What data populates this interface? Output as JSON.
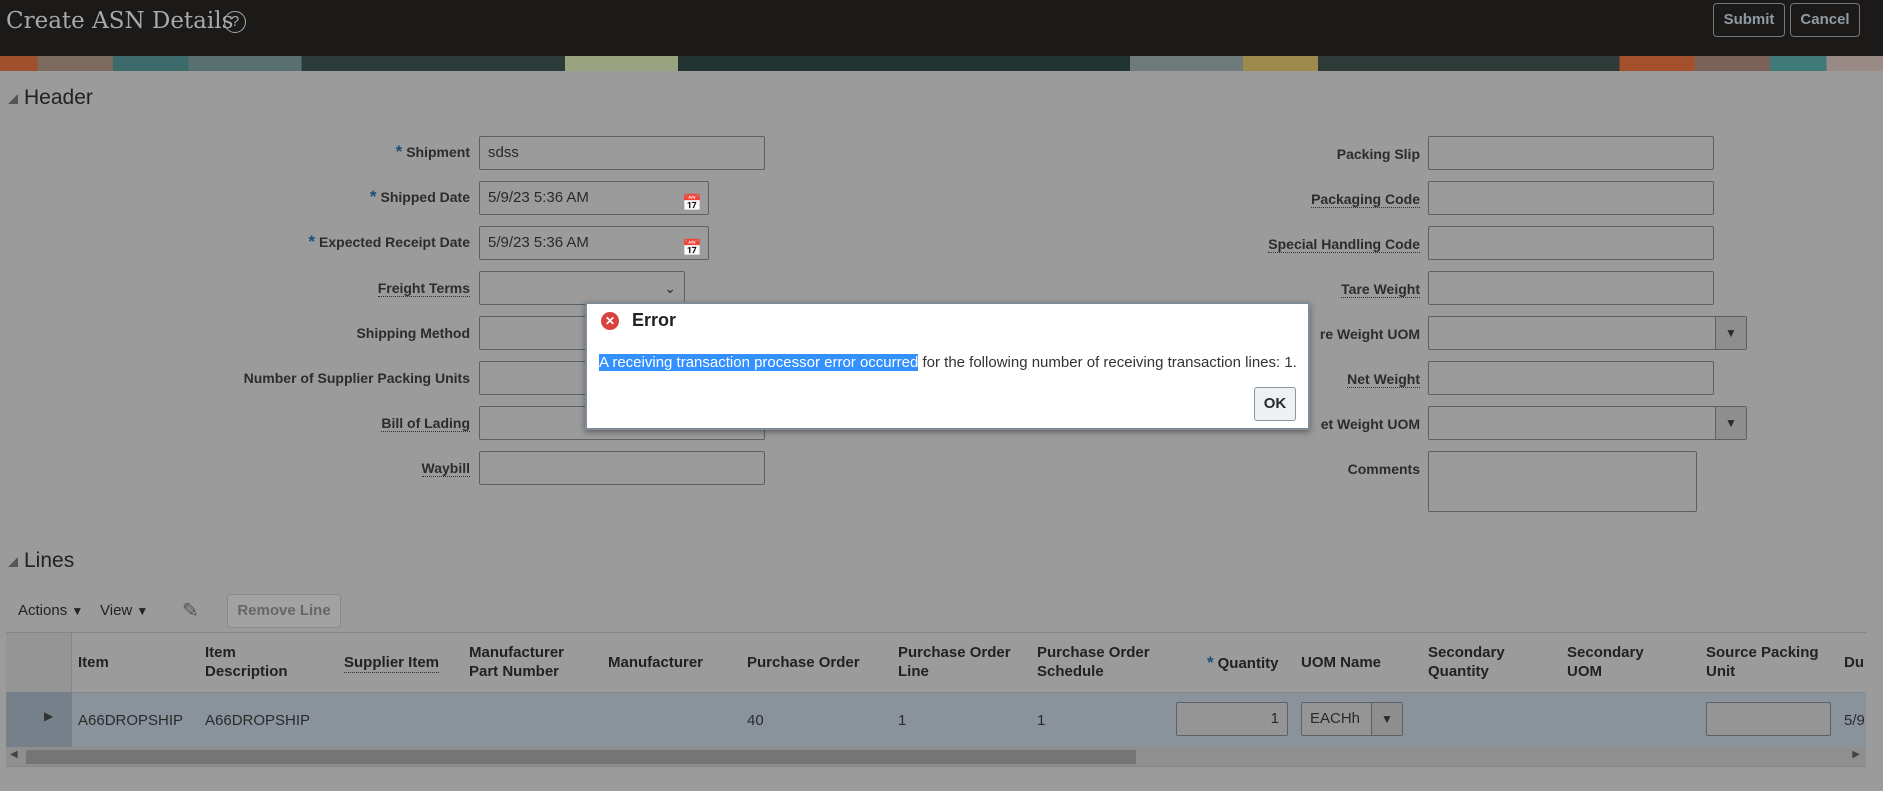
{
  "page": {
    "title": "Create ASN Details",
    "help_icon": "?",
    "submit_label": "Submit",
    "cancel_label": "Cancel"
  },
  "header": {
    "section_title": "Header",
    "left_fields": [
      {
        "label": "Shipment",
        "required": "*",
        "value": "sdss"
      },
      {
        "label": "Shipped Date",
        "required": "*",
        "value": "5/9/23 5:36 AM"
      },
      {
        "label": "Expected Receipt Date",
        "required": "*",
        "value": "5/9/23 5:36 AM"
      },
      {
        "label": "Freight Terms",
        "value": ""
      },
      {
        "label": "Shipping Method",
        "value": ""
      },
      {
        "label": "Number of Supplier Packing Units",
        "value": ""
      },
      {
        "label": "Bill of Lading",
        "value": ""
      },
      {
        "label": "Waybill",
        "value": ""
      }
    ],
    "right_fields": [
      {
        "label": "Packing Slip",
        "value": ""
      },
      {
        "label": "Packaging Code",
        "value": ""
      },
      {
        "label": "Special Handling Code",
        "value": ""
      },
      {
        "label": "Tare Weight",
        "value": ""
      },
      {
        "label": "re Weight UOM",
        "value": ""
      },
      {
        "label": "Net Weight",
        "value": ""
      },
      {
        "label": "et Weight UOM",
        "value": ""
      },
      {
        "label": "Comments",
        "value": ""
      }
    ]
  },
  "dialog": {
    "title": "Error",
    "message_highlighted": "A receiving transaction processor error occurred",
    "message_rest": " for the following number of receiving transaction lines: 1.",
    "ok_label": "OK"
  },
  "lines": {
    "section_title": "Lines",
    "actions_label": "Actions",
    "view_label": "View",
    "remove_line_label": "Remove Line",
    "columns": [
      "Item",
      "Item Description",
      "Supplier Item",
      "Manufacturer Part Number",
      "Manufacturer",
      "Purchase Order",
      "Purchase Order Line",
      "Purchase Order Schedule",
      "Quantity",
      "UOM Name",
      "Secondary Quantity",
      "Secondary UOM",
      "Source Packing Unit",
      "Du"
    ],
    "quantity_required": "*",
    "row": {
      "item": "A66DROPSHIP",
      "item_description": "A66DROPSHIP",
      "purchase_order": "40",
      "po_line": "1",
      "po_schedule": "1",
      "quantity": "1",
      "uom_name": "EACHh",
      "source_packing_unit": "",
      "due": "5/9"
    }
  }
}
